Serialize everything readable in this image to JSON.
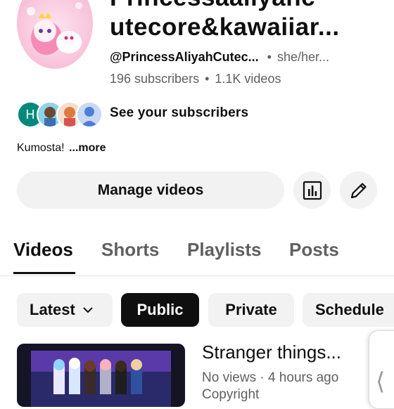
{
  "channel": {
    "name_line_1": "Princessaaliyahc",
    "name_line_2": "utecore&kawaiiar...",
    "handle": "@PrincessAliyahCutec...",
    "pronouns": "she/her...",
    "separator": "•",
    "subscribers": "196 subscribers",
    "videos": "1.1K videos",
    "see_subscribers": "See your subscribers",
    "subscriber_initial": "H",
    "about": "Kumosta!",
    "more": "...more"
  },
  "actions": {
    "manage_videos": "Manage videos"
  },
  "tabs": [
    "Videos",
    "Shorts",
    "Playlists",
    "Posts"
  ],
  "filters": {
    "latest": "Latest",
    "chips": [
      "Public",
      "Private",
      "Schedule"
    ]
  },
  "video": {
    "title": "Stranger things...",
    "meta": "No views · 4 hours ago",
    "extra": "Copyright"
  },
  "icons": {
    "sort": "chevron-down-icon",
    "analytics": "analytics-icon",
    "edit": "pencil-icon",
    "side": "chevron-left-icon"
  },
  "colors": {
    "text": "#0f0f0f",
    "secondary": "#606060",
    "chip_bg": "#f2f2f2",
    "chip_selected": "#0f0f0f"
  }
}
